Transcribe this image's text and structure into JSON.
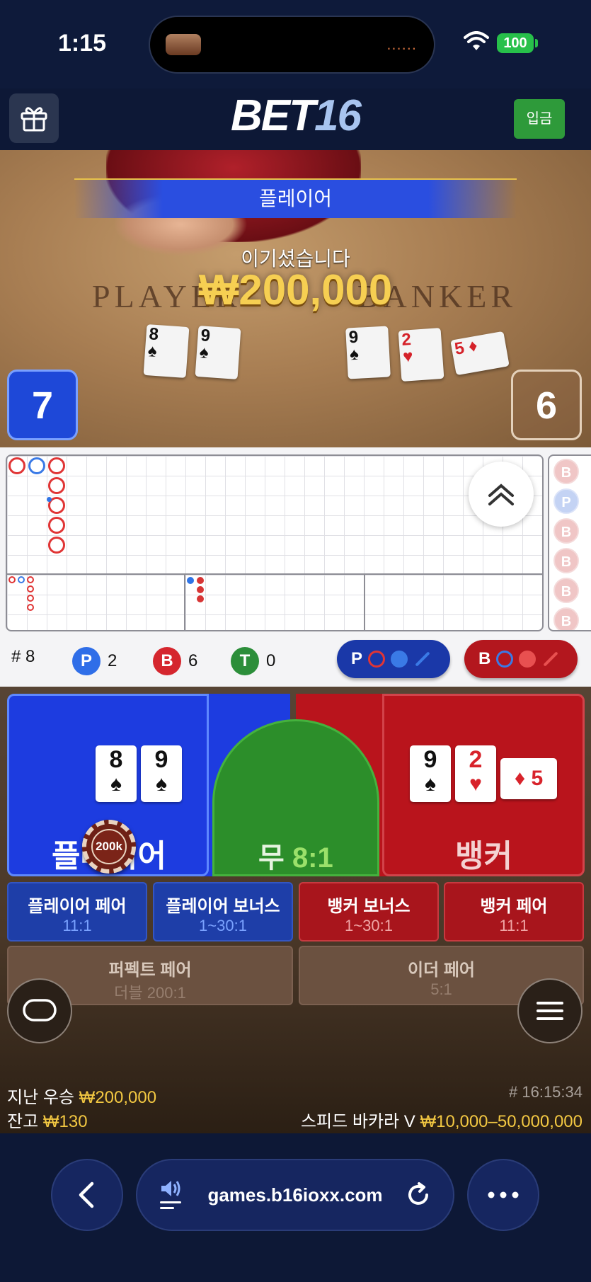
{
  "status_bar": {
    "time": "1:15",
    "battery": "100",
    "island_dots": "......"
  },
  "header": {
    "logo_main": "BET",
    "logo_num": "16",
    "deposit_label": "입금"
  },
  "video": {
    "banner": "플레이어",
    "win_text": "이기셨습니다",
    "win_amount": "₩200,000",
    "table_left": "PLAYER",
    "table_right": "BANKER",
    "player_score": "7",
    "banker_score": "6",
    "player_cards": [
      {
        "rank": "8",
        "suit": "♠"
      },
      {
        "rank": "9",
        "suit": "♠"
      }
    ],
    "banker_cards": [
      {
        "rank": "9",
        "suit": "♠"
      },
      {
        "rank": "2",
        "suit": "♥"
      },
      {
        "rank": "5",
        "suit": "♦"
      }
    ]
  },
  "roadmap": {
    "bead_labels": [
      "B",
      "P",
      "B",
      "B",
      "B",
      "B"
    ],
    "counts": {
      "round_prefix": "# 8",
      "player_letter": "P",
      "player_count": "2",
      "banker_letter": "B",
      "banker_count": "6",
      "tie_letter": "T",
      "tie_count": "0"
    },
    "predict_player": "P",
    "predict_banker": "B"
  },
  "betting": {
    "player_label": "플레이어",
    "tie_label": "무",
    "tie_odds": "8:1",
    "banker_label": "뱅커",
    "chip_label": "200k",
    "player_cards": [
      {
        "rank": "8",
        "suit": "♠"
      },
      {
        "rank": "9",
        "suit": "♠"
      }
    ],
    "banker_cards": [
      {
        "rank": "9",
        "suit": "♠"
      },
      {
        "rank": "2",
        "suit": "♥"
      },
      {
        "rank": "5",
        "suit": "♦"
      }
    ],
    "side_bets": [
      {
        "label": "플레이어 페어",
        "odds": "11:1"
      },
      {
        "label": "플레이어 보너스",
        "odds": "1~30:1"
      },
      {
        "label": "뱅커 보너스",
        "odds": "1~30:1"
      },
      {
        "label": "뱅커 페어",
        "odds": "11:1"
      },
      {
        "label": "퍼펙트 페어",
        "odds": "더블 200:1"
      },
      {
        "label": "이더 페어",
        "odds": "5:1"
      }
    ]
  },
  "footer": {
    "last_win_label": "지난 우승",
    "last_win_amount": "₩200,000",
    "balance_label": "잔고",
    "balance_amount": "₩130",
    "round_id": "# 16:15:34",
    "table_name": "스피드 바카라 V",
    "limits": "₩10,000–50,000,000"
  },
  "browser": {
    "url": "games.b16ioxx.com"
  },
  "colors": {
    "player_blue": "#1d3ce0",
    "banker_red": "#b9141c",
    "tie_green": "#2c8e2a",
    "gold": "#f3c842",
    "deposit_green": "#2e9a3a"
  },
  "icons": [
    "wifi-icon",
    "gift-icon",
    "chevron-up-double-icon",
    "chat-icon",
    "menu-icon",
    "back-icon",
    "speaker-icon",
    "reload-icon",
    "more-icon"
  ]
}
